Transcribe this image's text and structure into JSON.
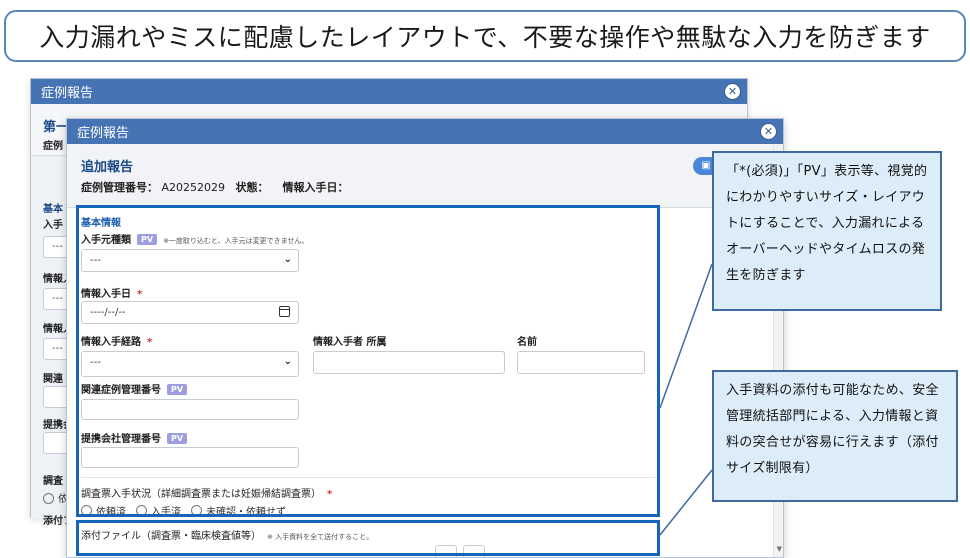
{
  "headline": "入力漏れやミスに配慮したレイアウトで、不要な操作や無駄な入力を防ぎます",
  "back_dialog": {
    "title": "症例報告",
    "heading": "第一",
    "subline": "症例",
    "section": "基本",
    "labels": [
      "入手",
      "情報入",
      "情報入",
      "関連",
      "提携会",
      "調査",
      "添付フ"
    ],
    "field_value": "---",
    "radio_label": "依"
  },
  "front_dialog": {
    "title": "症例報告",
    "heading": "追加報告",
    "meta": {
      "case_no_label": "症例管理番号：",
      "case_no_value": "A20252029",
      "status_label": "状態：",
      "date_label": "情報入手日："
    },
    "header_button_icon": "save-icon",
    "section_title": "基本情報",
    "fields": {
      "source_type": {
        "label": "入手元種類",
        "badge": "PV",
        "note": "※一度取り込むと、入手元は変更できません。",
        "value": "---"
      },
      "info_date": {
        "label": "情報入手日",
        "required_mark": "*",
        "placeholder": "----/--/--"
      },
      "info_route": {
        "label": "情報入手経路",
        "required_mark": "*",
        "value": "---"
      },
      "informant_affiliation": {
        "label": "情報入手者 所属",
        "value": ""
      },
      "name": {
        "label": "名前",
        "value": ""
      },
      "related_case_no": {
        "label": "関連症例管理番号",
        "badge": "PV",
        "value": ""
      },
      "partner_case_no": {
        "label": "提携会社管理番号",
        "badge": "PV",
        "value": ""
      },
      "survey_status": {
        "label": "調査票入手状況（詳細調査票または妊娠帰結調査票）",
        "required_mark": "*",
        "options": [
          "依頼済",
          "入手済",
          "未確認・依頼せず"
        ]
      },
      "attachment": {
        "label": "添付ファイル（調査票・臨床検査値等）",
        "note": "※ 入手資料を全て送付すること。"
      }
    }
  },
  "callouts": {
    "top": "「*(必須)」「PV」表示等、視覚的にわかりやすいサイズ・レイアウトにすることで、入力漏れによるオーバーヘッドやタイムロスの発生を防ぎます",
    "bottom": "入手資料の添付も可能なため、安全管理統括部門による、入力情報と資料の突合せが容易に行えます（添付サイズ制限有）"
  },
  "colors": {
    "titlebar": "#4673b4",
    "highlight": "#1565b8",
    "callout_bg": "#dcecf9",
    "required": "#d0343f",
    "pv_badge": "#9d9ee0"
  }
}
